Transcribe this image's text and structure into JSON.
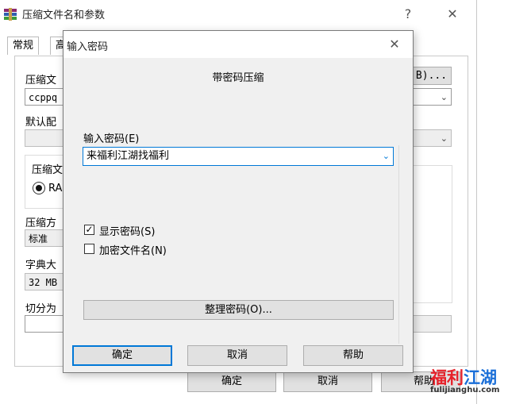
{
  "background_window": {
    "title": "压缩文件名和参数",
    "help_glyph": "?",
    "close_glyph": "✕",
    "tabs": [
      "常规",
      "高"
    ],
    "archive_name_label": "压缩文",
    "archive_name_value": "ccppq",
    "browse_label": "B)...",
    "default_profile_label": "默认配",
    "archive_format_label": "压缩文",
    "format_radio_label": "RA",
    "method_label": "压缩方",
    "method_value": "标准",
    "dict_label": "字典大",
    "dict_value": "32 MB",
    "split_label": "切分为",
    "ok_label": "确定",
    "cancel_label": "取消",
    "help_label": "帮助"
  },
  "dialog": {
    "title": "输入密码",
    "close_glyph": "✕",
    "heading": "带密码压缩",
    "password_label": "输入密码(E)",
    "password_value": "来福利江湖找福利",
    "show_password_label": "显示密码(S)",
    "show_password_checked": true,
    "encrypt_names_label": "加密文件名(N)",
    "encrypt_names_checked": false,
    "organize_button": "整理密码(O)...",
    "ok_button": "确定",
    "cancel_button": "取消",
    "help_button": "帮助"
  },
  "watermark": {
    "line1_a": "福利",
    "line1_b": "江湖",
    "line2": "fulijianghu.com"
  },
  "colors": {
    "accent_blue": "#0078d7",
    "watermark_red": "#e6212a",
    "watermark_blue": "#1b6fd8"
  },
  "icons": {
    "app_icon": "winrar-icon",
    "checkmark": "✓",
    "combo": "chevron-down-icon"
  }
}
